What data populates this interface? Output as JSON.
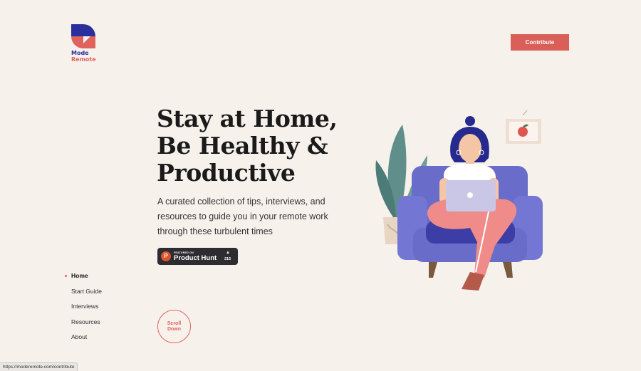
{
  "header": {
    "logo_text_line1": "Mode",
    "logo_text_line2": "Remote",
    "contribute_label": "Contribute"
  },
  "hero": {
    "title": "Stay at Home, Be Healthy & Productive",
    "subtitle": "A curated collection of tips, interviews, and resources to guide you in your remote work through these turbulent times"
  },
  "product_hunt_badge": {
    "small_label": "FEATURED ON",
    "name": "Product Hunt",
    "logo_letter": "P",
    "upvote_icon": "triangle-up-icon",
    "count": "215"
  },
  "nav": {
    "items": [
      {
        "label": "Home",
        "active": true
      },
      {
        "label": "Start Guide",
        "active": false
      },
      {
        "label": "Interviews",
        "active": false
      },
      {
        "label": "Resources",
        "active": false
      },
      {
        "label": "About",
        "active": false
      }
    ]
  },
  "scroll_button": {
    "line1": "Scroll",
    "line2": "Down"
  },
  "status_bar": {
    "url": "https://moderemote.com/contribute"
  },
  "colors": {
    "background": "#f7f1ec",
    "accent": "#d95f58",
    "navy": "#2b2f9e",
    "sofa": "#6a6cc9"
  }
}
